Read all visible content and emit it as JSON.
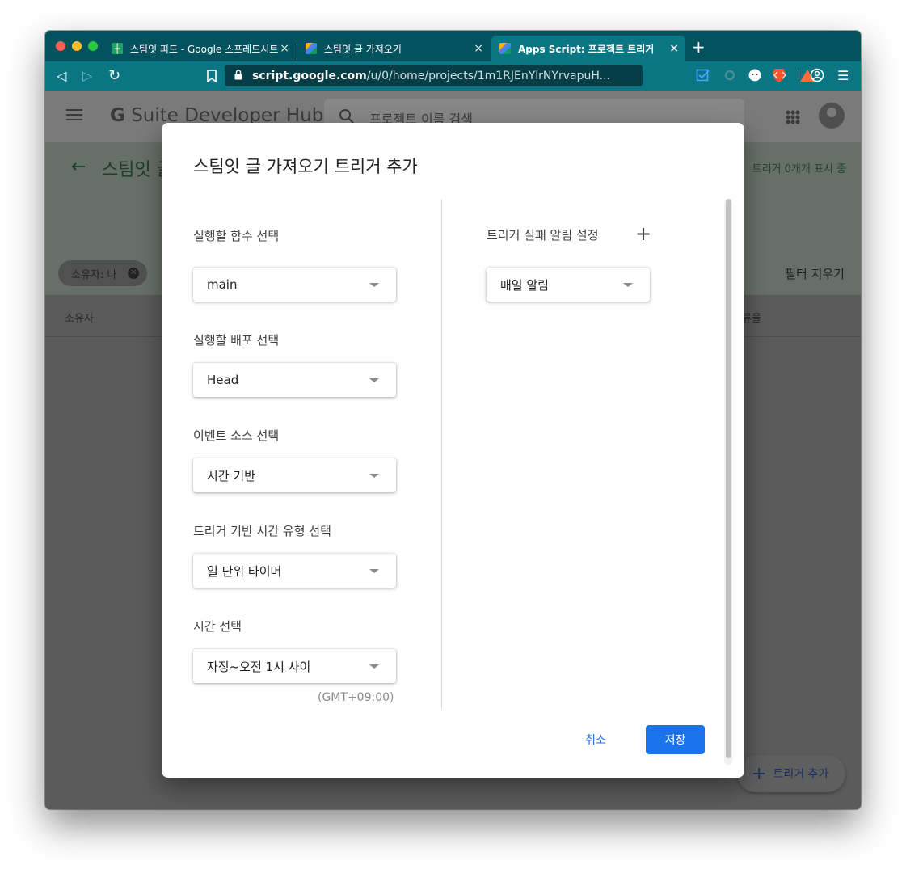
{
  "browser": {
    "tabs": [
      {
        "label": "스팀잇 피드 - Google 스프레드시트",
        "icon": "sheets-icon",
        "close": "×"
      },
      {
        "label": "스팀잇 글 가져오기",
        "icon": "apps-script-icon",
        "close": "×"
      },
      {
        "label": "Apps Script: 프로젝트 트리거",
        "icon": "apps-script-icon",
        "close": "×",
        "active": true
      }
    ],
    "new_tab": "+",
    "url": {
      "host": "script.google.com",
      "path": "/u/0/home/projects/1m1RJEnYlrNYrvapuH..."
    },
    "nav": {
      "back": "◁",
      "forward": "▷",
      "reload": "↻",
      "menu": "☰"
    }
  },
  "app": {
    "brand_g": "G",
    "brand_rest": " Suite Developer Hub",
    "search_placeholder": "프로젝트 이름 검색",
    "project_title": "스팀잇 글",
    "trigger_count": "트리거 0개개 표시 중",
    "filter_chip": "소유자: 나",
    "clear_filter": "필터 지우기",
    "columns": {
      "owner": "소유자",
      "error_rate": "류율"
    },
    "fab_label": "트리거 추가",
    "fab_plus": "+",
    "back_arrow": "←"
  },
  "dialog": {
    "title": "스팀잇 글 가져오기 트리거 추가",
    "fields": [
      {
        "label": "실행할 함수 선택",
        "value": "main"
      },
      {
        "label": "실행할 배포 선택",
        "value": "Head"
      },
      {
        "label": "이벤트 소스 선택",
        "value": "시간 기반"
      },
      {
        "label": "트리거 기반 시간 유형 선택",
        "value": "일 단위 타이머"
      },
      {
        "label": "시간 선택",
        "value": "자정~오전 1시 사이"
      }
    ],
    "timezone": "(GMT+09:00)",
    "notification": {
      "label": "트리거 실패 알림 설정",
      "add": "+",
      "value": "매일 알림"
    },
    "cancel": "취소",
    "save": "저장"
  },
  "colors": {
    "accent": "#1a73e8",
    "tab_bar": "#05525f",
    "nav_bar": "#0a7583"
  }
}
